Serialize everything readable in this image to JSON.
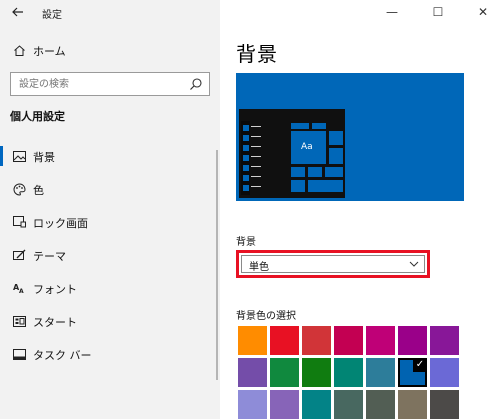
{
  "app": {
    "title": "設定",
    "back_icon": "back-arrow-icon"
  },
  "sidebar": {
    "home_label": "ホーム",
    "search": {
      "placeholder": "設定の検索"
    },
    "section_title": "個人用設定",
    "items": [
      {
        "label": "背景",
        "icon": "picture-icon",
        "active": true
      },
      {
        "label": "色",
        "icon": "palette-icon",
        "active": false
      },
      {
        "label": "ロック画面",
        "icon": "lock-screen-icon",
        "active": false
      },
      {
        "label": "テーマ",
        "icon": "theme-icon",
        "active": false
      },
      {
        "label": "フォント",
        "icon": "font-icon",
        "active": false
      },
      {
        "label": "スタート",
        "icon": "start-icon",
        "active": false
      },
      {
        "label": "タスク バー",
        "icon": "taskbar-icon",
        "active": false
      }
    ]
  },
  "window_controls": {
    "minimize": "—",
    "maximize": "☐",
    "close": "✕"
  },
  "main": {
    "page_title": "背景",
    "preview": {
      "tile_text": "Aa"
    },
    "background_label": "背景",
    "background_value": "単色",
    "color_section_label": "背景色の選択",
    "accent_color": "#0067b8",
    "highlight_color": "#e81123",
    "swatch_colors": [
      [
        "#ff8c00",
        "#e81123",
        "#d13438",
        "#c30052",
        "#bf0077",
        "#9a0089",
        "#881798"
      ],
      [
        "#744da9",
        "#10893e",
        "#107c10",
        "#018574",
        "#2d7d9a",
        "#0063b1",
        "#6b69d6"
      ],
      [
        "#8e8cd8",
        "#8764b8",
        "#038387",
        "#486860",
        "#525e54",
        "#7e735f",
        "#4c4a48"
      ]
    ],
    "selected_swatch": {
      "row": 1,
      "col": 5
    }
  }
}
